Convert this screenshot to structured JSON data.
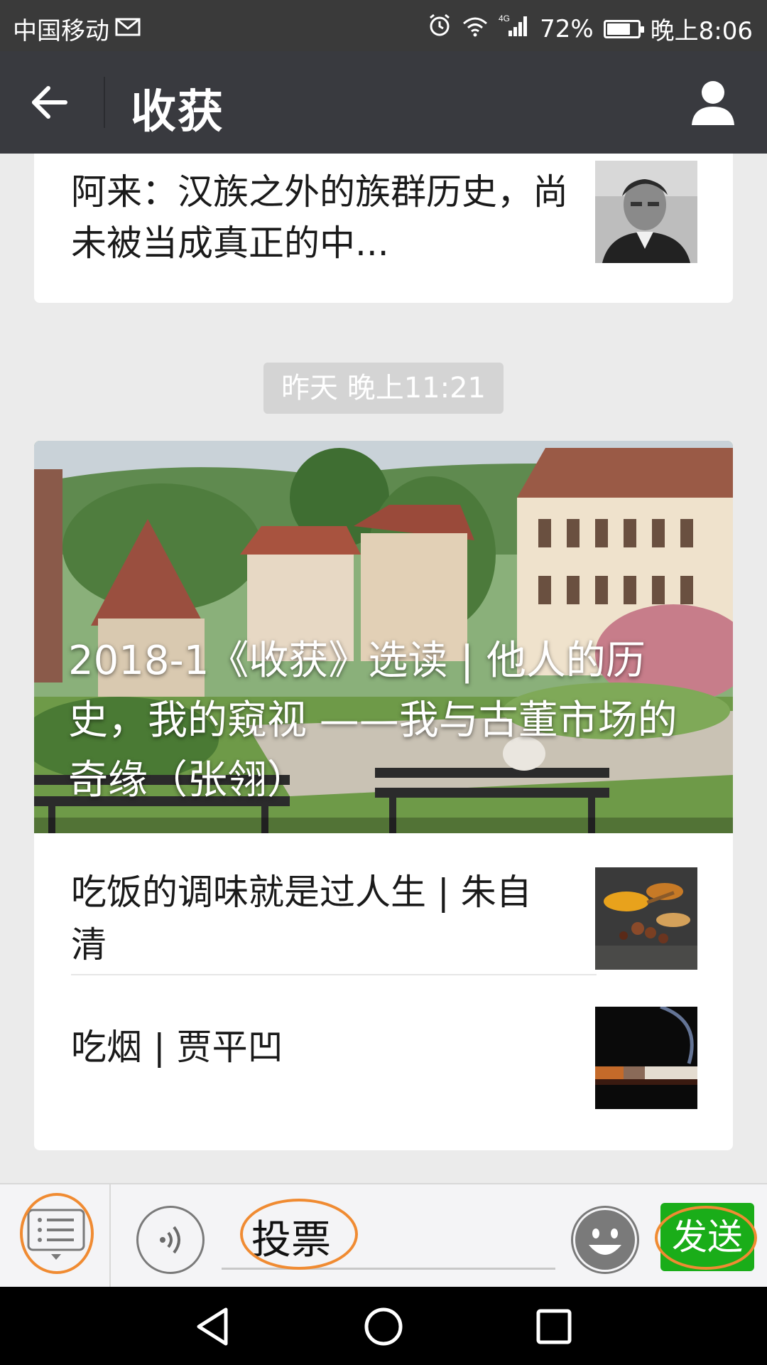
{
  "status_bar": {
    "carrier": "中国移动",
    "network": "4G",
    "battery": "72%",
    "battery_level": 0.72,
    "time": "晚上8:06",
    "icons": [
      "mail-icon",
      "alarm-icon",
      "wifi-icon",
      "signal-icon",
      "battery-icon"
    ]
  },
  "header": {
    "title": "收获",
    "back_icon": "arrow-left-icon",
    "profile_icon": "person-icon"
  },
  "messages": {
    "prev_article": {
      "title": "阿来：汉族之外的族群历史，尚未被当成真正的中..."
    },
    "timestamp": "昨天 晚上11:21",
    "main": {
      "headline": "2018-1《收获》选读 | 他人的历史，我的窥视 ——我与古董市场的奇缘（张翎）",
      "items": [
        {
          "title": "吃饭的调味就是过人生 | 朱自清"
        },
        {
          "title": "吃烟 | 贾平凹"
        }
      ]
    }
  },
  "input_bar": {
    "text": "投票",
    "send_label": "发送",
    "accent_color": "#1aad19",
    "highlight_color": "#f08b32",
    "icons": [
      "menu-list-icon",
      "voice-icon",
      "emoji-icon"
    ]
  },
  "nav": {
    "icons": [
      "back-triangle-icon",
      "home-circle-icon",
      "recents-square-icon"
    ]
  }
}
